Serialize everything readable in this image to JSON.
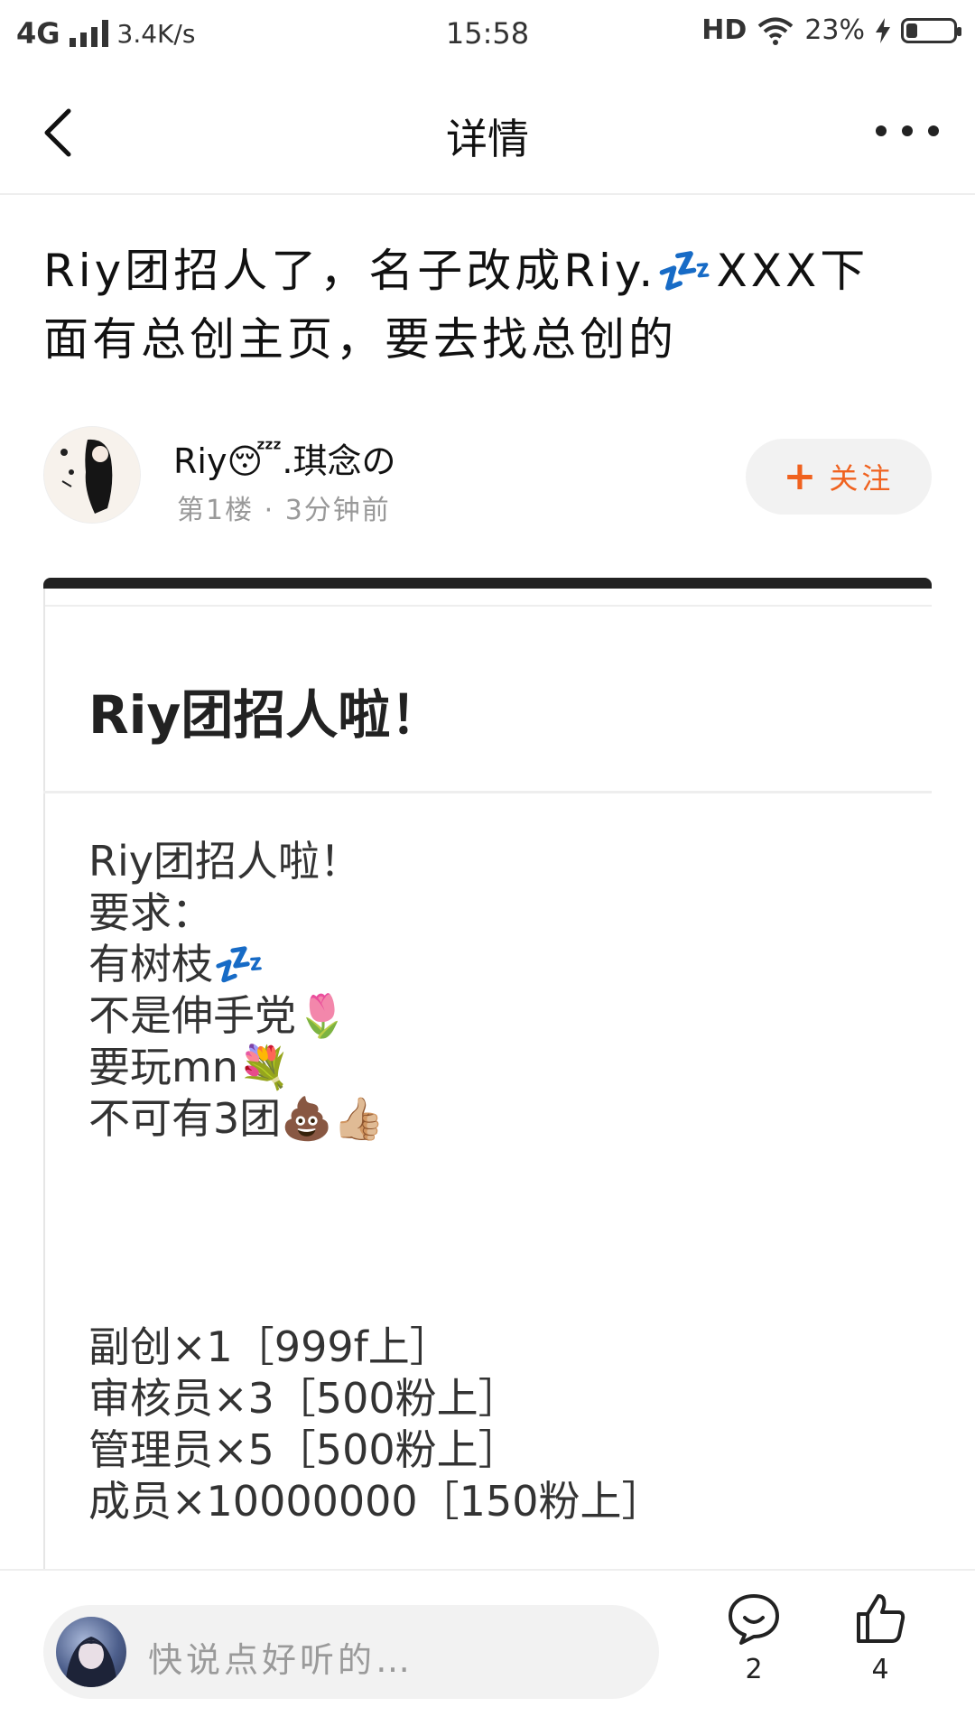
{
  "status_bar": {
    "network": "4G",
    "speed": "3.4K/s",
    "time": "15:58",
    "hd": "HD",
    "battery": "23%",
    "battery_level": 0.23
  },
  "nav": {
    "title": "详情"
  },
  "post": {
    "title": "Riy团招人了，名子改成Riy.💤XXX下面有总创主页，要去找总创的",
    "author": {
      "name": "Riy😴.琪念の",
      "meta": "第1楼 · 3分钟前"
    },
    "follow_label": "关注",
    "follow_plus": "+"
  },
  "card": {
    "title": "Riy团招人啦！",
    "lines": [
      "Riy团招人啦！",
      "要求：",
      "有树枝💤",
      "不是伸手党🌷",
      "要玩mn💐",
      "不可有3团💩👍🏼"
    ],
    "roles": [
      "副创×1［999f上］",
      "审核员×3［500粉上］",
      "管理员×5［500粉上］",
      "成员×10000000［150粉上］"
    ]
  },
  "bottom_bar": {
    "comment_placeholder": "快说点好听的…",
    "comment_count": "2",
    "like_count": "4"
  },
  "colors": {
    "accent": "#f0621f",
    "text": "#111111",
    "muted": "#999999"
  }
}
